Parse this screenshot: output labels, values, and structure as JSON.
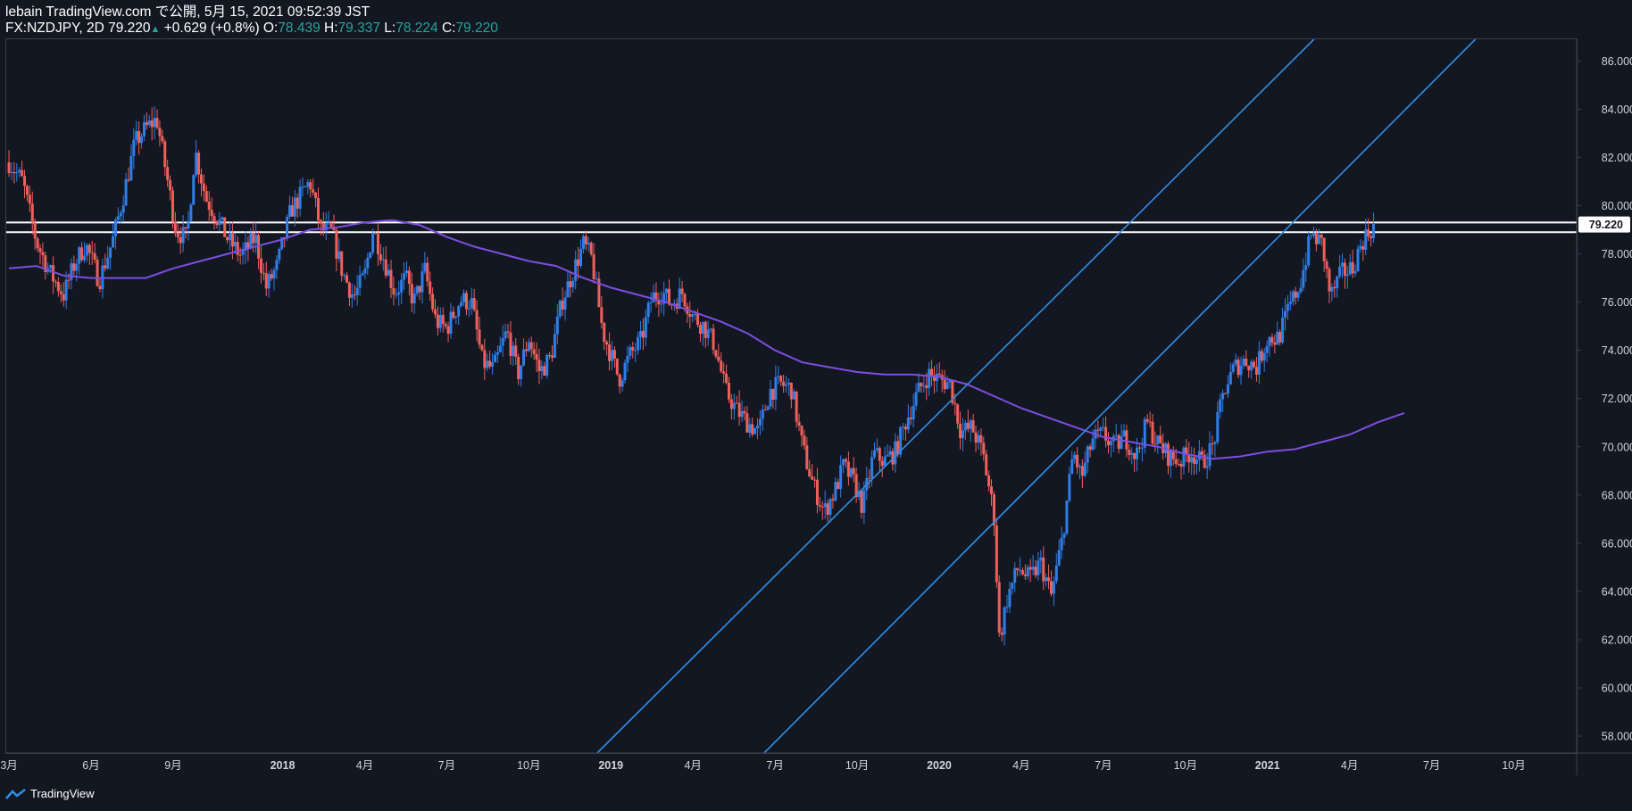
{
  "header": {
    "line1": "lebain TradingView.com で公開, 5月 15, 2021 09:52:39 JST",
    "symbol_prefix": "FX:NZDJPY, 2D 79.220",
    "change": "+0.629 (+0.8%)",
    "o_label": "O:",
    "o_value": "78.439",
    "h_label": "H:",
    "h_value": "79.337",
    "l_label": "L:",
    "l_value": "78.224",
    "c_label": "C:",
    "c_value": "79.220"
  },
  "footer": {
    "brand": "TradingView"
  },
  "chart_data": {
    "type": "candlestick",
    "symbol": "FX:NZDJPY",
    "timeframe": "2D",
    "last_price": 79.22,
    "ylim": [
      57.3,
      86.9
    ],
    "y_ticks": [
      58,
      60,
      62,
      64,
      66,
      68,
      70,
      72,
      74,
      76,
      78,
      80,
      82,
      84,
      86
    ],
    "y_tick_labels": [
      "58.000",
      "60.000",
      "62.000",
      "64.000",
      "66.000",
      "68.000",
      "70.000",
      "72.000",
      "74.000",
      "76.000",
      "78.000",
      "80.000",
      "82.000",
      "84.000",
      "86.000"
    ],
    "x_ticks": [
      {
        "label": "3月",
        "pos": 0
      },
      {
        "label": "6月",
        "pos": 3
      },
      {
        "label": "9月",
        "pos": 6
      },
      {
        "label": "2018",
        "pos": 10
      },
      {
        "label": "4月",
        "pos": 13
      },
      {
        "label": "7月",
        "pos": 16
      },
      {
        "label": "10月",
        "pos": 19
      },
      {
        "label": "2019",
        "pos": 22
      },
      {
        "label": "4月",
        "pos": 25
      },
      {
        "label": "7月",
        "pos": 28
      },
      {
        "label": "10月",
        "pos": 31
      },
      {
        "label": "2020",
        "pos": 34
      },
      {
        "label": "4月",
        "pos": 37
      },
      {
        "label": "7月",
        "pos": 40
      },
      {
        "label": "10月",
        "pos": 43
      },
      {
        "label": "2021",
        "pos": 46
      },
      {
        "label": "4月",
        "pos": 49
      },
      {
        "label": "7月",
        "pos": 52
      },
      {
        "label": "10月",
        "pos": 55
      }
    ],
    "x_range": [
      -0.1,
      57.3
    ],
    "close_path": [
      [
        0,
        81.8
      ],
      [
        0.5,
        81.0
      ],
      [
        1.0,
        78.5
      ],
      [
        1.5,
        77.2
      ],
      [
        2.0,
        76.3
      ],
      [
        2.4,
        77.6
      ],
      [
        2.8,
        78.4
      ],
      [
        3.3,
        76.9
      ],
      [
        3.8,
        78.6
      ],
      [
        4.2,
        80.5
      ],
      [
        4.6,
        82.6
      ],
      [
        5.0,
        83.2
      ],
      [
        5.4,
        83.6
      ],
      [
        5.8,
        81.0
      ],
      [
        6.1,
        79.0
      ],
      [
        6.5,
        78.6
      ],
      [
        6.8,
        82.3
      ],
      [
        7.2,
        80.3
      ],
      [
        7.6,
        79.5
      ],
      [
        8.0,
        78.6
      ],
      [
        8.5,
        77.9
      ],
      [
        9.0,
        78.7
      ],
      [
        9.4,
        76.6
      ],
      [
        9.8,
        77.5
      ],
      [
        10.3,
        79.8
      ],
      [
        10.6,
        80.3
      ],
      [
        11.0,
        81.0
      ],
      [
        11.4,
        79.0
      ],
      [
        11.8,
        78.9
      ],
      [
        12.2,
        77.2
      ],
      [
        12.6,
        76.2
      ],
      [
        13.0,
        77.1
      ],
      [
        13.3,
        79.0
      ],
      [
        13.7,
        77.8
      ],
      [
        14.1,
        76.4
      ],
      [
        14.5,
        77.0
      ],
      [
        14.8,
        76.0
      ],
      [
        15.2,
        77.3
      ],
      [
        15.6,
        75.2
      ],
      [
        16.0,
        74.9
      ],
      [
        16.5,
        76.1
      ],
      [
        16.9,
        76.0
      ],
      [
        17.3,
        73.5
      ],
      [
        17.7,
        73.2
      ],
      [
        18.2,
        74.8
      ],
      [
        18.6,
        73.0
      ],
      [
        19.0,
        74.5
      ],
      [
        19.4,
        73.1
      ],
      [
        19.8,
        73.7
      ],
      [
        20.2,
        76.0
      ],
      [
        20.6,
        77.2
      ],
      [
        21.0,
        78.4
      ],
      [
        21.3,
        77.8
      ],
      [
        21.7,
        74.8
      ],
      [
        22.0,
        73.8
      ],
      [
        22.3,
        72.8
      ],
      [
        22.7,
        73.8
      ],
      [
        23.1,
        74.4
      ],
      [
        23.5,
        76.2
      ],
      [
        23.9,
        76.4
      ],
      [
        24.2,
        75.9
      ],
      [
        24.6,
        76.4
      ],
      [
        25.0,
        75.4
      ],
      [
        25.4,
        75.0
      ],
      [
        25.8,
        74.2
      ],
      [
        26.2,
        72.3
      ],
      [
        26.6,
        71.5
      ],
      [
        27.0,
        71.0
      ],
      [
        27.4,
        70.6
      ],
      [
        27.8,
        72.3
      ],
      [
        28.2,
        72.6
      ],
      [
        28.6,
        72.4
      ],
      [
        29.0,
        70.0
      ],
      [
        29.4,
        68.4
      ],
      [
        29.8,
        67.3
      ],
      [
        30.2,
        68.2
      ],
      [
        30.5,
        69.2
      ],
      [
        30.9,
        68.5
      ],
      [
        31.2,
        67.5
      ],
      [
        31.6,
        69.7
      ],
      [
        32.0,
        69.4
      ],
      [
        32.4,
        69.8
      ],
      [
        32.8,
        71.1
      ],
      [
        33.2,
        72.2
      ],
      [
        33.6,
        73.0
      ],
      [
        34.0,
        72.8
      ],
      [
        34.4,
        72.6
      ],
      [
        34.8,
        70.6
      ],
      [
        35.2,
        70.8
      ],
      [
        35.6,
        69.7
      ],
      [
        36.0,
        67.2
      ],
      [
        36.2,
        62.0
      ],
      [
        36.5,
        63.8
      ],
      [
        36.9,
        65.0
      ],
      [
        37.3,
        64.5
      ],
      [
        37.7,
        65.2
      ],
      [
        38.1,
        63.8
      ],
      [
        38.5,
        66.2
      ],
      [
        38.9,
        69.8
      ],
      [
        39.2,
        68.7
      ],
      [
        39.6,
        70.3
      ],
      [
        40.0,
        70.5
      ],
      [
        40.4,
        70.0
      ],
      [
        40.8,
        70.4
      ],
      [
        41.2,
        69.6
      ],
      [
        41.6,
        71.0
      ],
      [
        42.0,
        70.1
      ],
      [
        42.4,
        69.6
      ],
      [
        42.8,
        69.4
      ],
      [
        43.2,
        69.8
      ],
      [
        43.6,
        69.3
      ],
      [
        44.0,
        70.0
      ],
      [
        44.4,
        72.3
      ],
      [
        44.8,
        73.3
      ],
      [
        45.2,
        73.6
      ],
      [
        45.6,
        73.3
      ],
      [
        46.0,
        74.5
      ],
      [
        46.4,
        74.5
      ],
      [
        46.8,
        75.8
      ],
      [
        47.2,
        76.8
      ],
      [
        47.6,
        78.8
      ],
      [
        48.0,
        78.4
      ],
      [
        48.3,
        76.2
      ],
      [
        48.7,
        77.2
      ],
      [
        49.1,
        77.4
      ],
      [
        49.5,
        78.6
      ],
      [
        49.9,
        79.2
      ]
    ],
    "ma_path": [
      [
        0,
        77.4
      ],
      [
        1,
        77.5
      ],
      [
        2,
        77.1
      ],
      [
        3,
        77.0
      ],
      [
        4,
        77.0
      ],
      [
        5,
        77.0
      ],
      [
        6,
        77.4
      ],
      [
        7,
        77.7
      ],
      [
        8,
        78.0
      ],
      [
        9,
        78.3
      ],
      [
        10,
        78.6
      ],
      [
        11,
        79.0
      ],
      [
        12,
        79.1
      ],
      [
        13,
        79.3
      ],
      [
        14,
        79.4
      ],
      [
        15,
        79.2
      ],
      [
        16,
        78.7
      ],
      [
        17,
        78.3
      ],
      [
        18,
        78.0
      ],
      [
        19,
        77.7
      ],
      [
        20,
        77.5
      ],
      [
        21,
        77.0
      ],
      [
        22,
        76.6
      ],
      [
        23,
        76.3
      ],
      [
        24,
        76.0
      ],
      [
        25,
        75.6
      ],
      [
        26,
        75.2
      ],
      [
        27,
        74.7
      ],
      [
        28,
        74.0
      ],
      [
        29,
        73.5
      ],
      [
        30,
        73.3
      ],
      [
        31,
        73.1
      ],
      [
        32,
        73.0
      ],
      [
        33,
        73.0
      ],
      [
        34,
        72.9
      ],
      [
        35,
        72.6
      ],
      [
        36,
        72.1
      ],
      [
        37,
        71.6
      ],
      [
        38,
        71.2
      ],
      [
        39,
        70.8
      ],
      [
        40,
        70.4
      ],
      [
        41,
        70.2
      ],
      [
        42,
        70.0
      ],
      [
        43,
        69.7
      ],
      [
        44,
        69.5
      ],
      [
        45,
        69.6
      ],
      [
        46,
        69.8
      ],
      [
        47,
        69.9
      ],
      [
        48,
        70.2
      ],
      [
        49,
        70.5
      ],
      [
        50,
        71.0
      ],
      [
        51,
        71.4
      ]
    ],
    "horizontal_lines": [
      79.3,
      78.9
    ],
    "channel_lines": [
      {
        "from": [
          21.5,
          57.3
        ],
        "to": [
          47.7,
          86.9
        ]
      },
      {
        "from": [
          27.6,
          57.3
        ],
        "to": [
          53.6,
          86.9
        ]
      }
    ],
    "colors": {
      "background": "#131722",
      "bull": "#2f7ee8",
      "bear": "#f0605a",
      "ma": "#7e4ee0",
      "channel": "#2f8fe8",
      "hline": "#ffffff",
      "axis_text": "#d1d4dc",
      "grid_border": "#3b3f4a",
      "price_label_bg": "#ffffff",
      "price_label_text": "#131722"
    },
    "grid": false
  }
}
